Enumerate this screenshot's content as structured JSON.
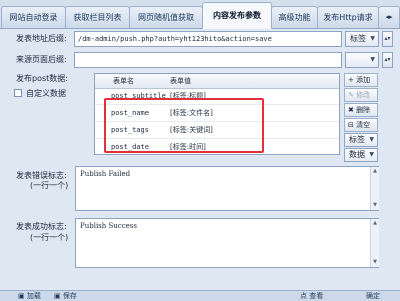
{
  "tabs": [
    {
      "label": "网站自动登录"
    },
    {
      "label": "获取栏目列表"
    },
    {
      "label": "网页随机值获取"
    },
    {
      "label": "内容发布参数",
      "active": true
    },
    {
      "label": "高级功能"
    },
    {
      "label": "发布Http请求"
    }
  ],
  "tab_arrows": "◂▸",
  "form": {
    "post_url_label": "发表地址后缀:",
    "post_url_value": "/dm-admin/push.php?auth=yht123hito&action=save",
    "post_url_combo": "标签",
    "referer_label": "来源页面后缀:",
    "referer_value": "",
    "post_data_label": "发布post数据:",
    "custom_data_label": "自定义数据"
  },
  "table": {
    "headers": [
      "表单名",
      "表单值"
    ],
    "rows": [
      {
        "name": "post_subtitle",
        "value": "[标签:标题]"
      },
      {
        "name": "post_name",
        "value": "[标签:文件名]"
      },
      {
        "name": "post_tags",
        "value": "[标签:关键词]"
      },
      {
        "name": "post_date",
        "value": "[标签:时间]"
      }
    ]
  },
  "side_buttons": {
    "add": "+ 添加",
    "edit": "✎ 修改",
    "delete": "✖ 删除",
    "clear": "⊟ 清空",
    "combo": "标签",
    "data_combo": "数据"
  },
  "error_section": {
    "label": "发表错误标志:",
    "sublabel": "(一行一个)",
    "value": "Publish Failed"
  },
  "success_section": {
    "label": "发表成功标志:",
    "sublabel": "(一行一个)",
    "value": "Publish Success"
  },
  "footer": {
    "left1": "▣ 加载",
    "left2": "▣ 保存",
    "right": "确定",
    "mid": "点 查看"
  },
  "colors": {
    "highlight": "#e0313a",
    "tab_active": "#f6f8fb",
    "accent": "#1f4f8f"
  }
}
